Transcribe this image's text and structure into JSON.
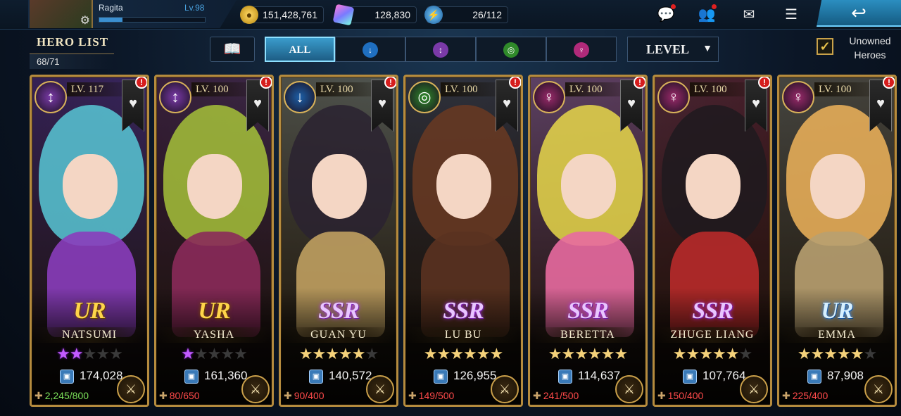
{
  "player": {
    "name": "Ragita",
    "level": "Lv.98",
    "xp_fraction": 0.22
  },
  "resources": {
    "gold": "151,428,761",
    "gems": "128,830",
    "energy": "26/112"
  },
  "header": {
    "title": "HERO LIST",
    "count": "68/71"
  },
  "filters": {
    "all_label": "ALL",
    "sort_label": "LEVEL",
    "unowned_label": "Unowned Heroes",
    "unowned_checked": true
  },
  "heroes": [
    {
      "level": "LV. 117",
      "rarity": "UR",
      "name": "NATSUMI",
      "power": "174,028",
      "shards": "2,245/800",
      "stars_on": 2,
      "stars_total": 5,
      "star_style": "purple",
      "shard_state": "ok",
      "class_color": "#7a3aa8",
      "hair": "#58c8d6",
      "outfit": "#8a3dbb"
    },
    {
      "level": "LV. 100",
      "rarity": "UR",
      "name": "YASHA",
      "power": "161,360",
      "shards": "80/650",
      "stars_on": 1,
      "stars_total": 5,
      "star_style": "purple",
      "shard_state": "low",
      "class_color": "#7a3aa8",
      "hair": "#a6c23a",
      "outfit": "#8b2a5a"
    },
    {
      "level": "LV. 100",
      "rarity": "SSR",
      "name": "GUAN YU",
      "power": "140,572",
      "shards": "90/400",
      "stars_on": 5,
      "stars_total": 6,
      "star_style": "gold",
      "shard_state": "low",
      "class_color": "#1d5fa8",
      "hair": "#2a2230",
      "outfit": "#c0a060"
    },
    {
      "level": "LV. 100",
      "rarity": "SSR",
      "name": "LU BU",
      "power": "126,955",
      "shards": "149/500",
      "stars_on": 6,
      "stars_total": 6,
      "star_style": "gold",
      "shard_state": "low",
      "class_color": "#2f8a2a",
      "hair": "#6a3a22",
      "outfit": "#5a3220"
    },
    {
      "level": "LV. 100",
      "rarity": "SSR",
      "name": "BERETTA",
      "power": "114,637",
      "shards": "241/500",
      "stars_on": 6,
      "stars_total": 6,
      "star_style": "gold",
      "shard_state": "low",
      "class_color": "#9a2a6a",
      "hair": "#e8d84a",
      "outfit": "#e86aa0"
    },
    {
      "level": "LV. 100",
      "rarity": "SSR",
      "name": "ZHUGE LIANG",
      "power": "107,764",
      "shards": "150/400",
      "stars_on": 5,
      "stars_total": 6,
      "star_style": "gold",
      "shard_state": "low",
      "class_color": "#9a2a6a",
      "hair": "#1e1a1e",
      "outfit": "#b82a2a"
    },
    {
      "level": "LV. 100",
      "rarity": "UR",
      "name": "EMMA",
      "power": "87,908",
      "shards": "225/400",
      "stars_on": 5,
      "stars_total": 6,
      "star_style": "gold",
      "shard_state": "low",
      "class_color": "#9a2a6a",
      "hair": "#f0b45a",
      "outfit": "#b8a070"
    }
  ]
}
